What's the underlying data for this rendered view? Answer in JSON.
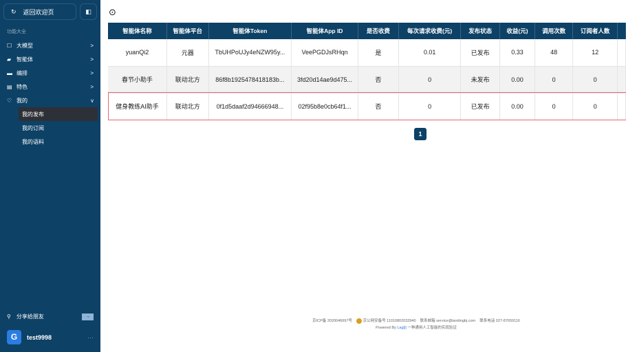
{
  "sidebar": {
    "back_label": "返回欢迎页",
    "section": "功能大全",
    "items": [
      {
        "label": "大模型",
        "chev": ">"
      },
      {
        "label": "智能体",
        "chev": ">"
      },
      {
        "label": "编排",
        "chev": ">"
      },
      {
        "label": "特色",
        "chev": ">"
      },
      {
        "label": "我的",
        "chev": "v"
      }
    ],
    "subitems": [
      "我的发布",
      "我的订阅",
      "我的语料"
    ],
    "share_label": "分享给朋友",
    "username": "test9998",
    "more": "···"
  },
  "table": {
    "headers": [
      "智能体名称",
      "智能体平台",
      "智能体Token",
      "智能体App ID",
      "是否收费",
      "每次请求收费(元)",
      "发布状态",
      "收益(元)",
      "调用次数",
      "订阅者人数",
      ""
    ],
    "rows": [
      [
        "yuanQi2",
        "元器",
        "TbUHPoUJy4eNZW95y...",
        "VeePGDJsRHqn",
        "是",
        "0.01",
        "已发布",
        "0.33",
        "48",
        "12",
        ""
      ],
      [
        "春节小助手",
        "联动北方",
        "86f8b1925478418183b...",
        "3fd20d14ae9d475...",
        "否",
        "0",
        "未发布",
        "0.00",
        "0",
        "0",
        ""
      ],
      [
        "健身教练AI助手",
        "联动北方",
        "0f1d5daaf2d94666948...",
        "02f95b8e0cb64f1...",
        "否",
        "0",
        "已发布",
        "0.00",
        "0",
        "0",
        ""
      ]
    ]
  },
  "pagination": {
    "current": "1"
  },
  "footer": {
    "icp": "京ICP备 2020046697号",
    "police": "京公网安备号 11010802033940",
    "email": "联系邮箱 service@landingbj.com",
    "phone": "联系电话 027-87659116",
    "powered": "Powered By",
    "link": "Lag[i]",
    "slogan": "一种通用人工智能的实现验证"
  }
}
